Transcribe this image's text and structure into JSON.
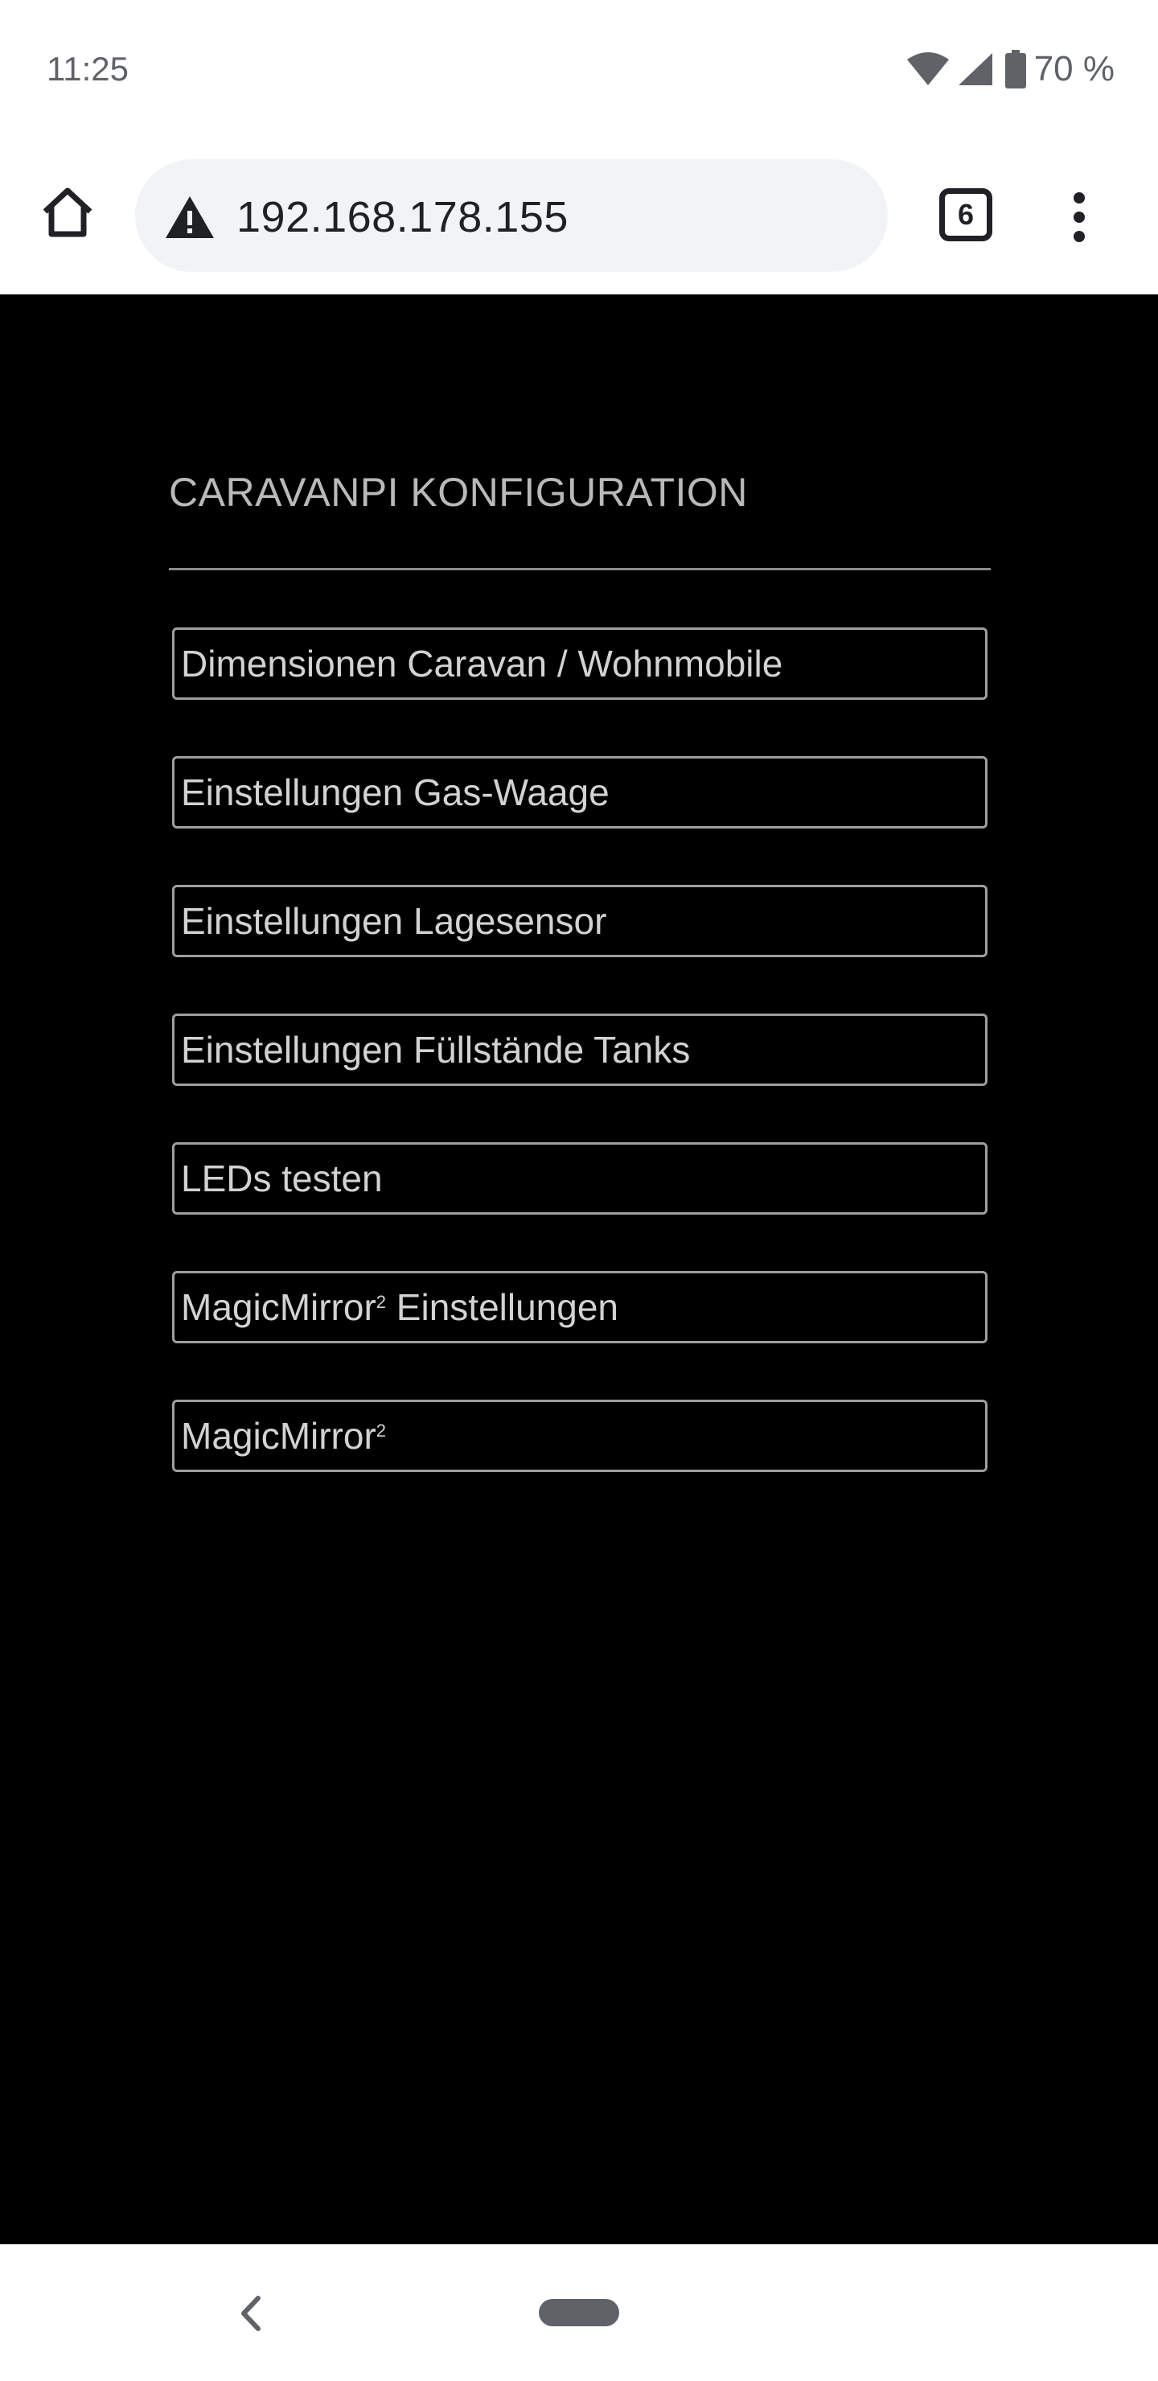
{
  "status_bar": {
    "time": "11:25",
    "battery_percent": "70 %",
    "icons": [
      "wifi-icon",
      "cell-signal-icon",
      "battery-icon"
    ]
  },
  "browser": {
    "url": "192.168.178.155",
    "tab_count": "6",
    "icons": [
      "home-icon",
      "not-secure-warning-icon",
      "tab-switcher-icon",
      "overflow-menu-icon"
    ]
  },
  "page": {
    "title": "CARAVANPI KONFIGURATION",
    "buttons": [
      {
        "label": "Dimensionen Caravan / Wohnmobile",
        "superscript": "",
        "suffix": ""
      },
      {
        "label": "Einstellungen Gas-Waage",
        "superscript": "",
        "suffix": ""
      },
      {
        "label": "Einstellungen Lagesensor",
        "superscript": "",
        "suffix": ""
      },
      {
        "label": "Einstellungen Füllstände Tanks",
        "superscript": "",
        "suffix": ""
      },
      {
        "label": "LEDs testen",
        "superscript": "",
        "suffix": ""
      },
      {
        "label": "MagicMirror",
        "superscript": "2",
        "suffix": " Einstellungen"
      },
      {
        "label": "MagicMirror",
        "superscript": "2",
        "suffix": ""
      }
    ]
  },
  "nav_bar": {
    "icons": [
      "back-icon",
      "home-pill-icon"
    ]
  },
  "colors": {
    "page_background": "#000000",
    "button_border": "#9e9e9e",
    "button_text": "#d2d2d2",
    "title_text": "#b9b9b9",
    "chrome_background": "#ffffff",
    "omnibox_background": "#f1f3f4"
  }
}
